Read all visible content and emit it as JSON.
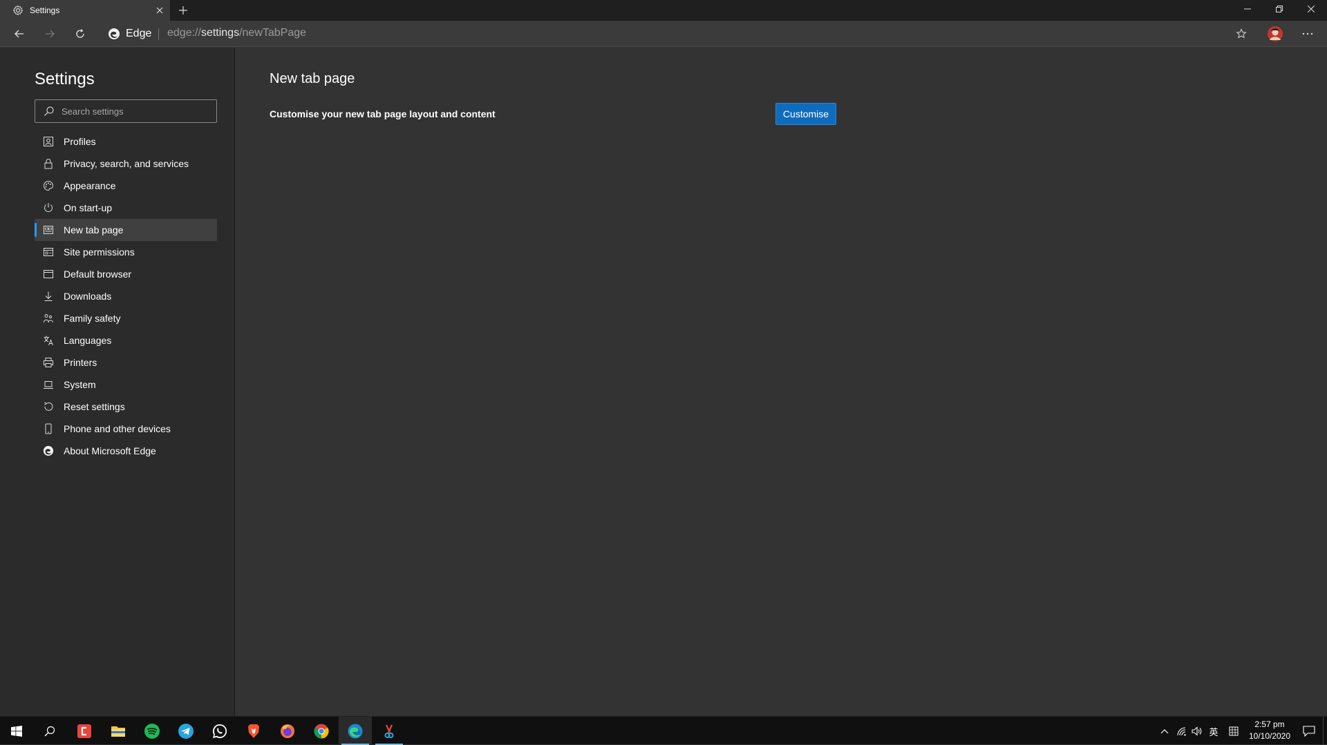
{
  "browser": {
    "tab_title": "Settings",
    "site_name": "Edge",
    "url_scheme": "edge://",
    "url_host": "settings",
    "url_path": "/newTabPage"
  },
  "sidebar": {
    "title": "Settings",
    "search_placeholder": "Search settings",
    "items": [
      {
        "label": "Profiles",
        "icon": "profile-icon"
      },
      {
        "label": "Privacy, search, and services",
        "icon": "lock-icon"
      },
      {
        "label": "Appearance",
        "icon": "palette-icon"
      },
      {
        "label": "On start-up",
        "icon": "power-icon"
      },
      {
        "label": "New tab page",
        "icon": "new-tab-icon",
        "active": true
      },
      {
        "label": "Site permissions",
        "icon": "site-permissions-icon"
      },
      {
        "label": "Default browser",
        "icon": "browser-window-icon"
      },
      {
        "label": "Downloads",
        "icon": "download-icon"
      },
      {
        "label": "Family safety",
        "icon": "family-icon"
      },
      {
        "label": "Languages",
        "icon": "language-icon"
      },
      {
        "label": "Printers",
        "icon": "printer-icon"
      },
      {
        "label": "System",
        "icon": "laptop-icon"
      },
      {
        "label": "Reset settings",
        "icon": "reset-icon"
      },
      {
        "label": "Phone and other devices",
        "icon": "phone-icon"
      },
      {
        "label": "About Microsoft Edge",
        "icon": "edge-logo-icon"
      }
    ]
  },
  "main": {
    "page_title": "New tab page",
    "row_description": "Customise your new tab page layout and content",
    "customise_label": "Customise"
  },
  "taskbar": {
    "apps": [
      "start-icon",
      "search-icon",
      "red-app-icon",
      "file-explorer-icon",
      "spotify-icon",
      "telegram-icon",
      "whatsapp-icon",
      "brave-icon",
      "firefox-icon",
      "chrome-icon",
      "edge-icon",
      "snipping-icon"
    ],
    "ime_label": "英",
    "time": "2:57 pm",
    "date": "10/10/2020"
  },
  "colors": {
    "accent": "#0f6cbd",
    "active_indicator": "#2899f5",
    "sidebar_bg": "#2b2b2b",
    "content_bg": "#333333"
  }
}
